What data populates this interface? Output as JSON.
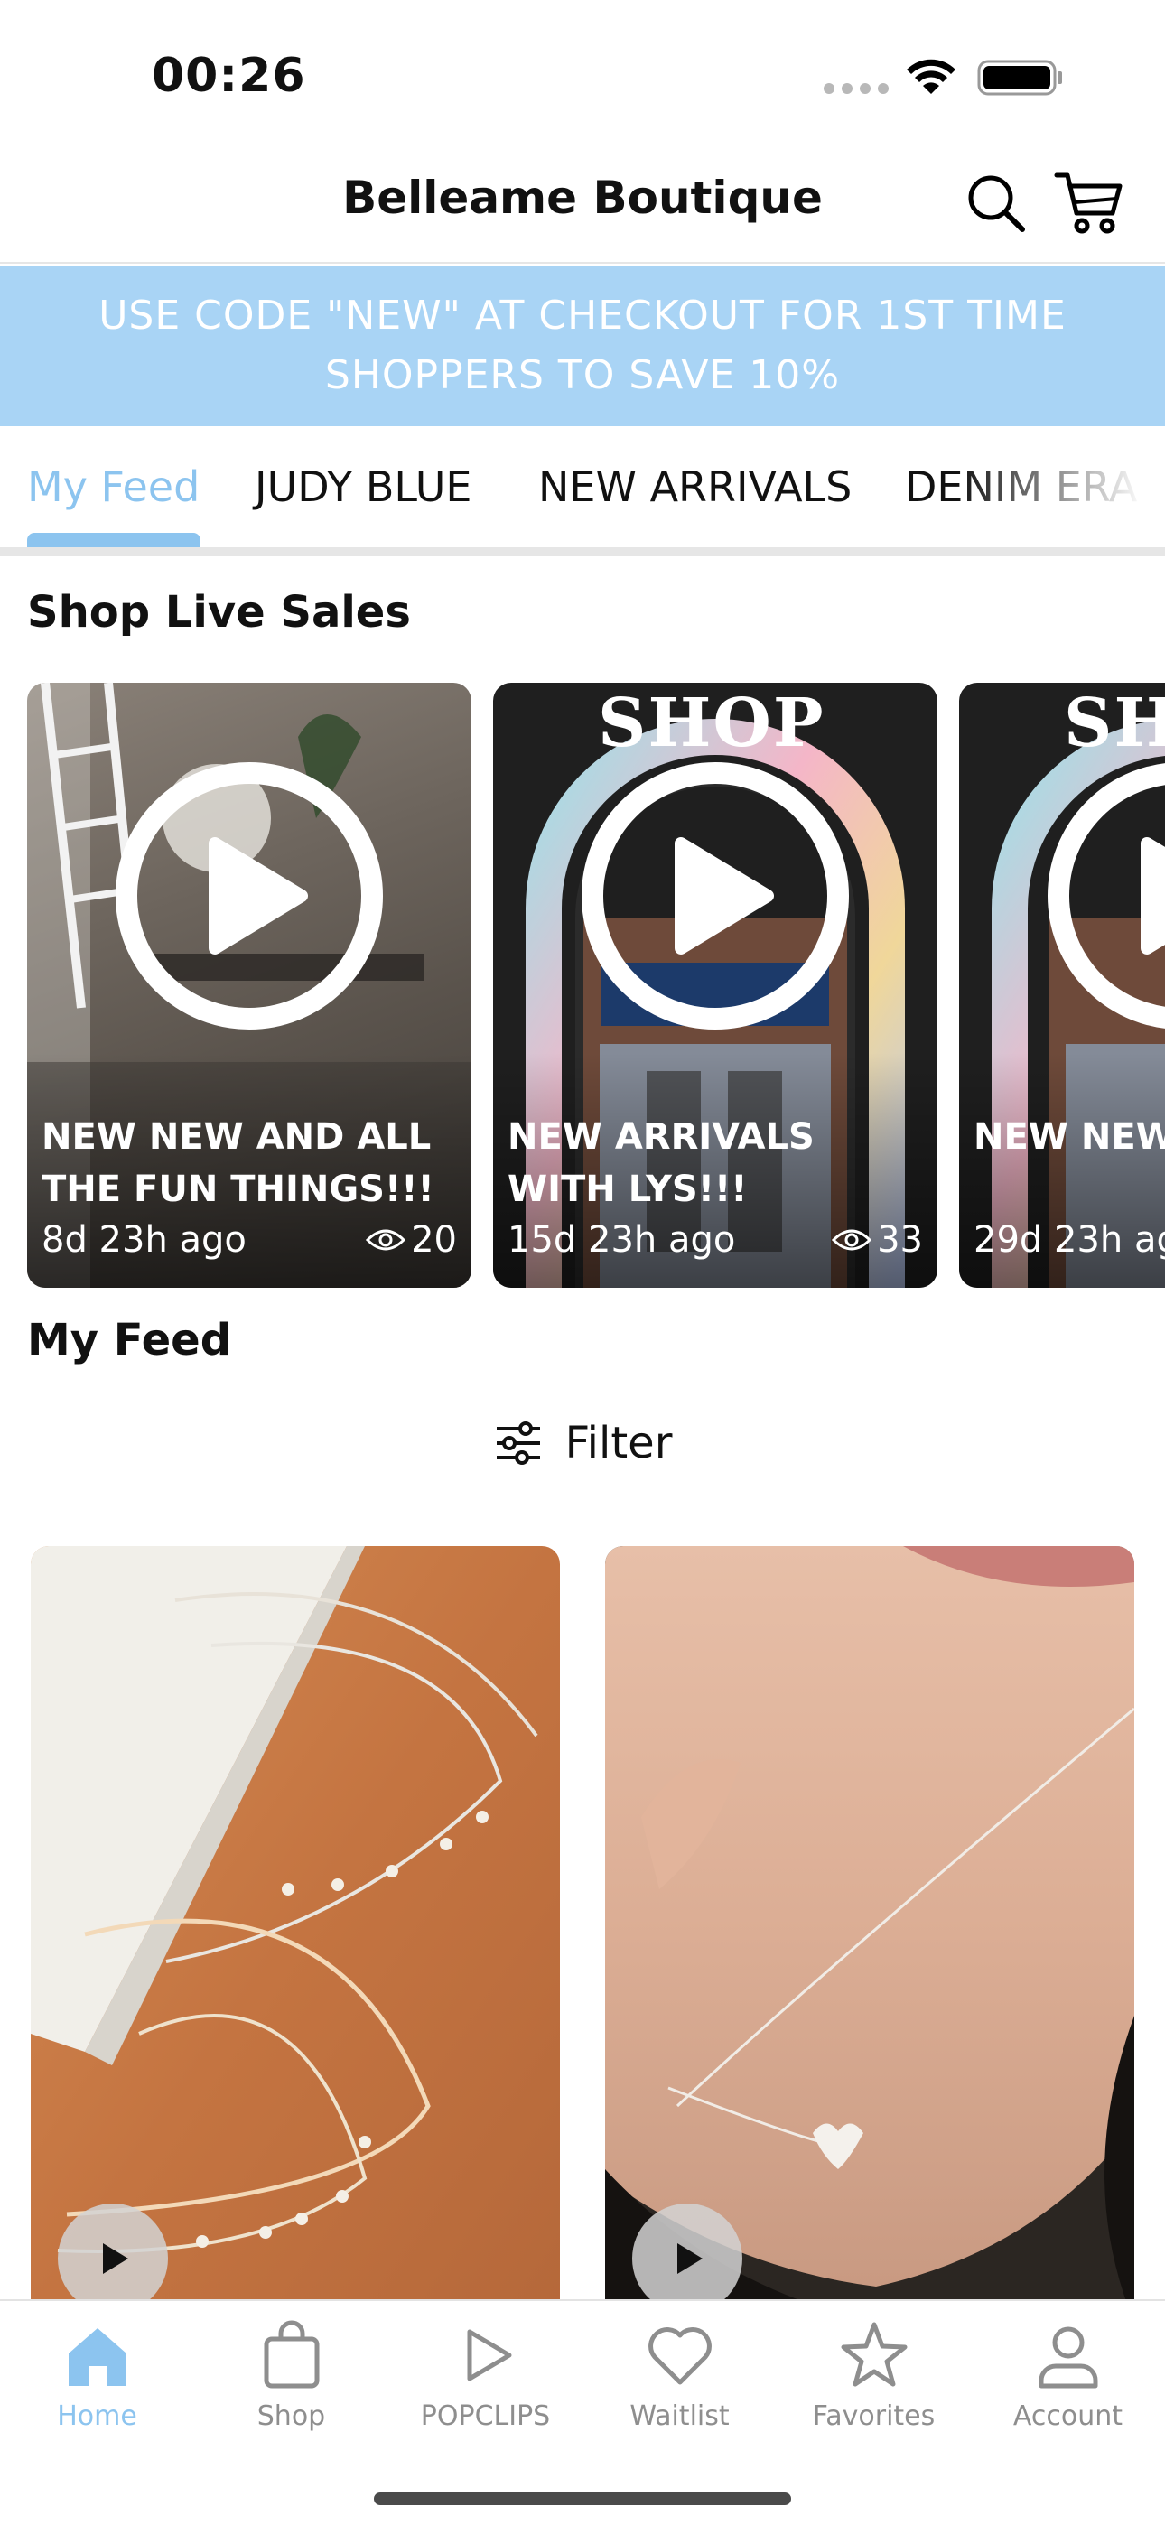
{
  "status_bar": {
    "time": "00:26"
  },
  "header": {
    "title": "Belleame Boutique",
    "search_icon": "search-icon",
    "cart_icon": "cart-icon"
  },
  "promo": {
    "text": "USE CODE \"NEW\" AT CHECKOUT FOR 1ST TIME SHOPPERS TO SAVE 10%",
    "color": "#a9d4f5"
  },
  "tabs": [
    {
      "label": "My Feed",
      "active": true
    },
    {
      "label": "JUDY BLUE",
      "active": false
    },
    {
      "label": "NEW ARRIVALS",
      "active": false
    },
    {
      "label": "DENIM ERA",
      "active": false
    }
  ],
  "accent_color": "#8cc4ef",
  "live_sales": {
    "title": "Shop Live Sales",
    "cards": [
      {
        "title": "NEW NEW AND ALL THE FUN THINGS!!!",
        "age": "8d 23h ago",
        "views": "20",
        "overlay_text": ""
      },
      {
        "title": "NEW ARRIVALS WITH LYS!!!",
        "age": "15d 23h ago",
        "views": "33",
        "overlay_text": "SHOP"
      },
      {
        "title": "NEW NEW",
        "age": "29d 23h ag",
        "views": "",
        "overlay_text": "SH"
      }
    ]
  },
  "feed": {
    "title": "My Feed",
    "filter_label": "Filter",
    "products": [
      {
        "image": "gold star layered necklaces"
      },
      {
        "image": "heart pendant necklace"
      }
    ]
  },
  "bottom_nav": [
    {
      "label": "Home",
      "icon": "home-icon",
      "active": true
    },
    {
      "label": "Shop",
      "icon": "shopping-bag-icon",
      "active": false
    },
    {
      "label": "POPCLIPS",
      "icon": "play-icon",
      "active": false
    },
    {
      "label": "Waitlist",
      "icon": "heart-icon",
      "active": false
    },
    {
      "label": "Favorites",
      "icon": "star-icon",
      "active": false
    },
    {
      "label": "Account",
      "icon": "person-icon",
      "active": false
    }
  ]
}
